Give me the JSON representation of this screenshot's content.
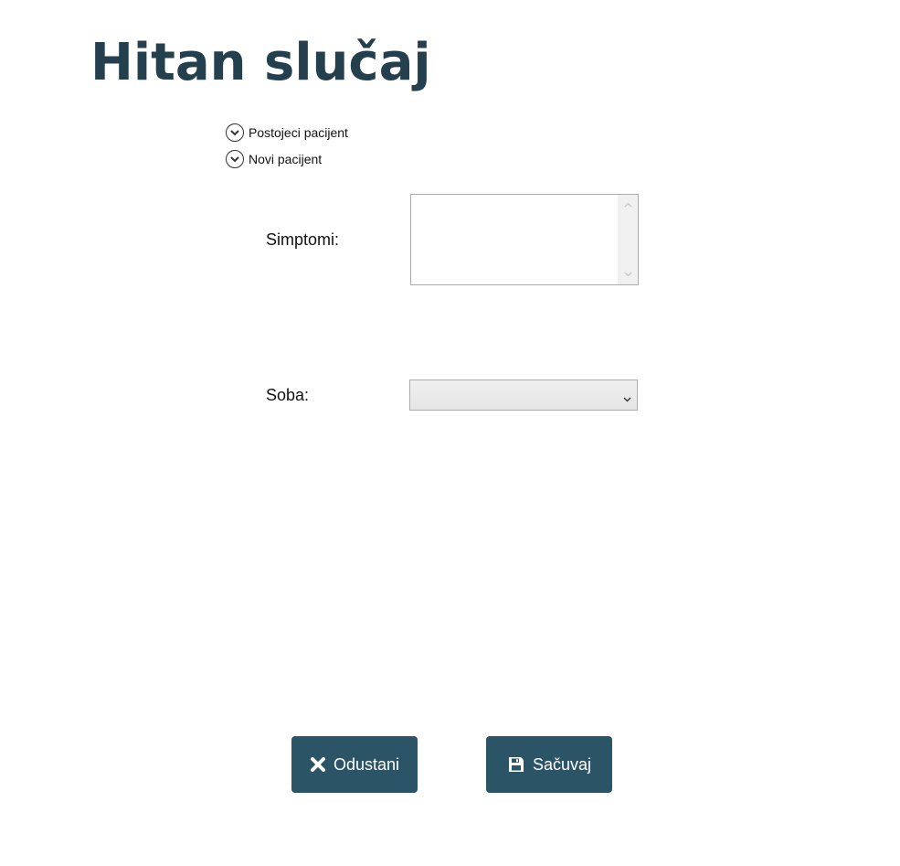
{
  "page": {
    "title": "Hitan slučaj"
  },
  "expanders": [
    {
      "label": "Postojeci pacijent",
      "icon": "chevron-down-circle-icon"
    },
    {
      "label": "Novi pacijent",
      "icon": "chevron-down-circle-icon"
    }
  ],
  "form": {
    "symptoms_label": "Simptomi:",
    "symptoms_value": "",
    "room_label": "Soba:",
    "room_selected": ""
  },
  "buttons": {
    "cancel_label": "Odustani",
    "cancel_icon": "close-icon",
    "save_label": "Sačuvaj",
    "save_icon": "save-icon"
  },
  "colors": {
    "title": "#243f4e",
    "button_bg": "#2b5466",
    "button_text": "#ffffff"
  }
}
